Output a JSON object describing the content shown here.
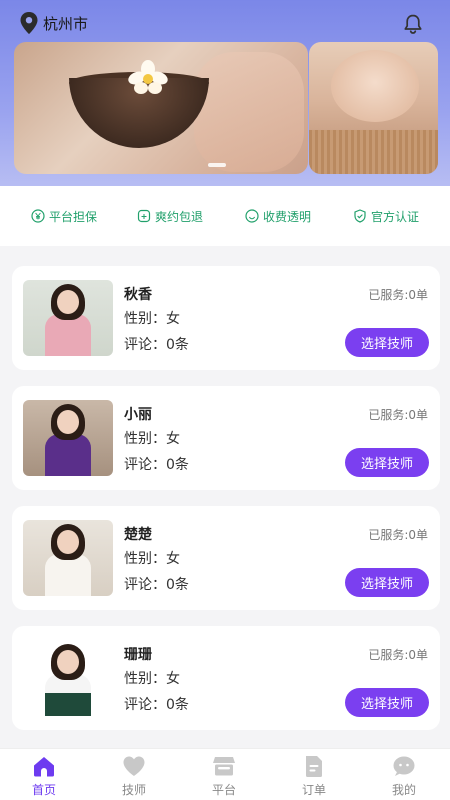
{
  "header": {
    "city": "杭州市",
    "location_icon": "location-pin-icon",
    "notification_icon": "bell-icon"
  },
  "features": [
    {
      "label": "平台担保",
      "icon": "yen-shield-icon"
    },
    {
      "label": "爽约包退",
      "icon": "refund-icon"
    },
    {
      "label": "收费透明",
      "icon": "smile-icon"
    },
    {
      "label": "官方认证",
      "icon": "verified-shield-icon"
    }
  ],
  "technicians": [
    {
      "name": "秋香",
      "gender": "性别：女",
      "reviews": "评论：0条",
      "served": "已服务:0单",
      "button": "选择技师"
    },
    {
      "name": "小丽",
      "gender": "性别：女",
      "reviews": "评论：0条",
      "served": "已服务:0单",
      "button": "选择技师"
    },
    {
      "name": "楚楚",
      "gender": "性别：女",
      "reviews": "评论：0条",
      "served": "已服务:0单",
      "button": "选择技师"
    },
    {
      "name": "珊珊",
      "gender": "性别：女",
      "reviews": "评论：0条",
      "served": "已服务:0单",
      "button": "选择技师"
    }
  ],
  "tabbar": [
    {
      "label": "首页",
      "icon": "home-icon",
      "active": true
    },
    {
      "label": "技师",
      "icon": "heart-icon",
      "active": false
    },
    {
      "label": "平台",
      "icon": "store-icon",
      "active": false
    },
    {
      "label": "订单",
      "icon": "order-document-icon",
      "active": false
    },
    {
      "label": "我的",
      "icon": "chat-face-icon",
      "active": false
    }
  ],
  "colors": {
    "accent": "#7b3ff0",
    "feature_green": "#21a06b",
    "header_gradient": "#7b87e8"
  }
}
